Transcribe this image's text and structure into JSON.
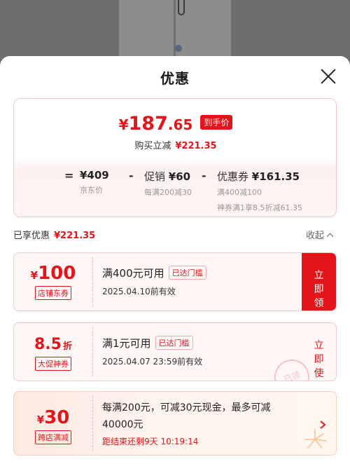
{
  "sheet": {
    "title": "优惠"
  },
  "summary": {
    "price_yen": "¥",
    "price_int": "187",
    "price_dec": ".65",
    "price_tag": "到手价",
    "savings_label": "购买立减",
    "savings_amount": "¥221.35"
  },
  "formula": {
    "eq": "=",
    "minus": "-",
    "base_price": "¥409",
    "base_label": "京东价",
    "promo_title": "促销",
    "promo_amount": "¥60",
    "promo_desc": "每满200减30",
    "coupon_title": "优惠券",
    "coupon_amount": "¥161.35",
    "coupon_desc1": "满400减100",
    "coupon_desc2": "神券满1享8.5折减61.35"
  },
  "enjoyed": {
    "label": "已享优惠",
    "amount": "¥221.35",
    "collapse": "收起"
  },
  "coupons": [
    {
      "value_prefix": "¥",
      "value": "100",
      "type_label": "店铺东券",
      "condition": "满400元可用",
      "pill": "已达门槛",
      "date": "2025.04.10前有效",
      "action": "立即领取"
    },
    {
      "value": "8.5",
      "value_suffix": "折",
      "type_label": "大促神券",
      "condition": "满1元可用",
      "pill": "已达门槛",
      "date": "2025.04.07  23:59前有效",
      "action": "立即使用",
      "stamp": "已领"
    },
    {
      "value_prefix": "¥",
      "value": "30",
      "type_label": "跨店满减",
      "condition_line1": "每满200元，可减30元现金，最多可减",
      "condition_line2": "40000元",
      "countdown": "距结束还剩9天 10:19:14"
    }
  ],
  "colors": {
    "accent": "#e4151a"
  },
  "icons": [
    "close-icon",
    "chevron-up-icon",
    "chevron-right-icon"
  ]
}
